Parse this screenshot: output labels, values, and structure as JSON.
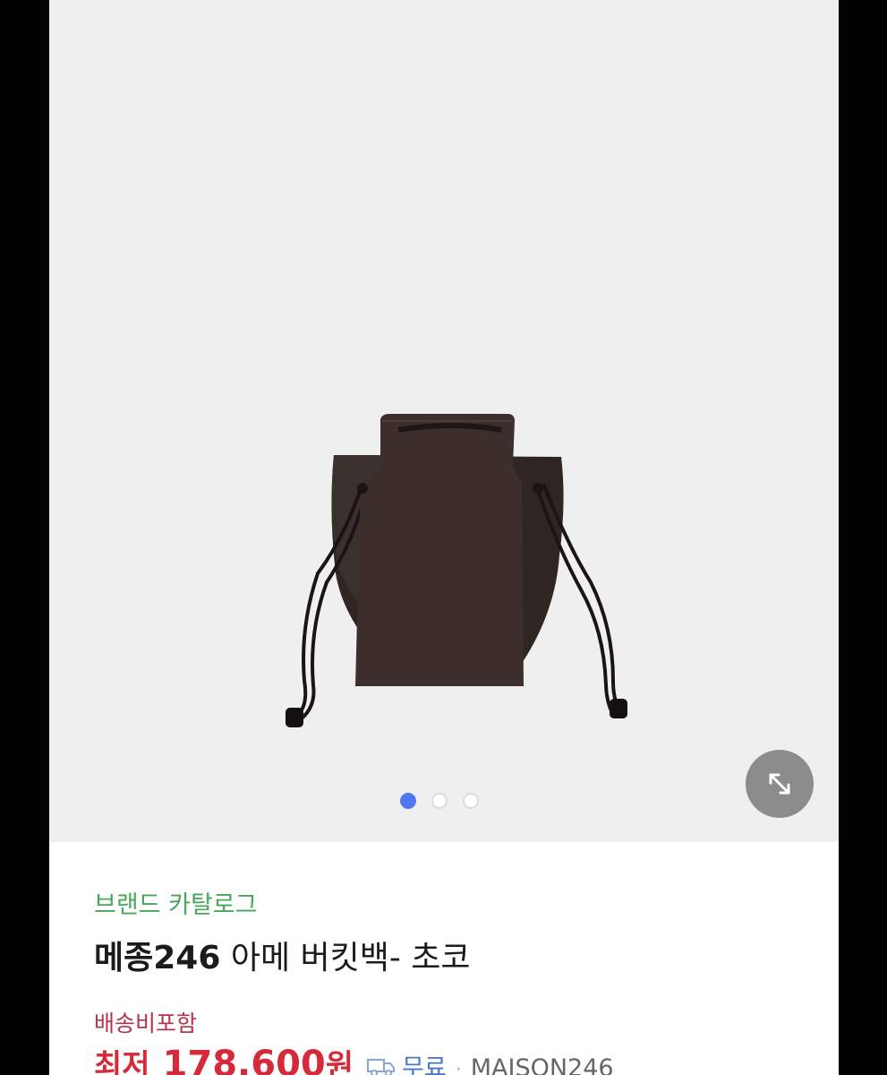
{
  "gallery": {
    "image_alt": "bucket bag product photo",
    "slide_count": 3,
    "active_slide": 1,
    "expand_icon": "expand-arrows-icon"
  },
  "product": {
    "brand_catalog_label": "브랜드 카탈로그",
    "title_brand": "메종246",
    "title_rest": " 아메 버킷백- 초코",
    "shipping_note": "배송비포함",
    "price_prefix": "최저",
    "price_value": "178,600",
    "price_unit": "원",
    "delivery_icon": "truck-icon",
    "delivery_label": "무료",
    "separator": "·",
    "seller": "MAISON246"
  },
  "colors": {
    "brand_green": "#45a85a",
    "price_red": "#d62a3b",
    "shipping_red": "#b5334b",
    "free_blue": "#4a78c2",
    "active_dot": "#4e79f0"
  }
}
